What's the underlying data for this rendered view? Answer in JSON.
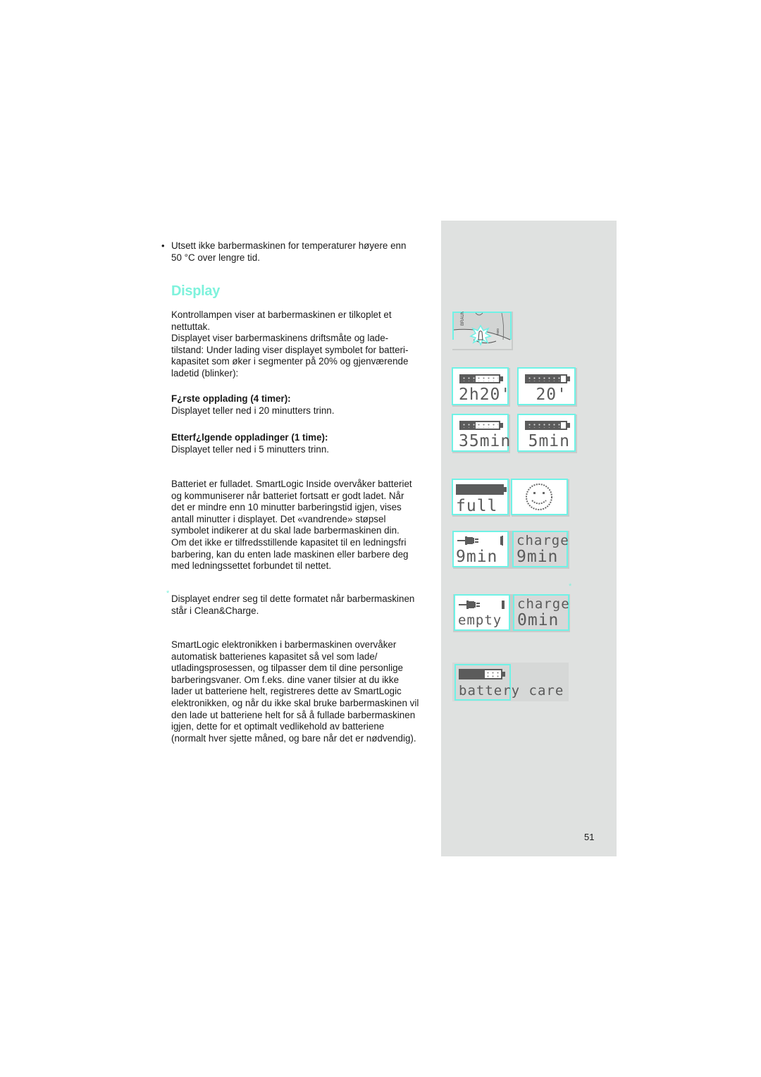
{
  "page": {
    "number": "51",
    "accent_color": "#7ef2dc",
    "sidebar_color": "#dfe1e0"
  },
  "content": {
    "bullet_symbol": "•",
    "warning_lines": [
      "Utsett ikke barbermaskinen for temperaturer høyere enn",
      "50 °C over lengre tid."
    ],
    "section_title": "Display",
    "intro_lines": [
      "Kontrollampen viser at barbermaskinen er tilkoplet et",
      "nettuttak.",
      "Displayet viser barbermaskinens driftsmåte og lade-",
      "tilstand: Under lading viser displayet symbolet for batteri-",
      "kapasitet som øker i segmenter på 20% og gjenværende",
      "ladetid (blinker):"
    ],
    "first_charge": {
      "heading": "F¿rste opplading (4 timer):",
      "text": "Displayet teller ned i 20 minutters trinn."
    },
    "subsequent_charge": {
      "heading": "Etterf¿lgende oppladinger (1 time):",
      "text": "Displayet teller ned i 5 minutters trinn."
    },
    "full_lines": [
      "Batteriet er fulladet. SmartLogic Inside overvåker batteriet",
      "og kommuniserer når batteriet fortsatt er godt ladet. Når",
      "det er mindre enn 10 minutter barberingstid igjen, vises",
      "antall minutter i displayet. Det «vandrende» støpsel",
      "symbolet indikerer at du skal lade barbermaskinen din.",
      "Om det ikke er tilfredsstillende kapasitet til en ledningsfri",
      "barbering, kan du enten lade maskinen eller barbere deg",
      "med ledningssettet forbundet til nettet."
    ],
    "footnote_marker": "*",
    "footnote_lines": [
      "Displayet endrer seg til dette formatet når barbermaskinen",
      "står i Clean&Charge."
    ],
    "smartlogic_lines": [
      "SmartLogic elektronikken i barbermaskinen overvåker",
      "automatisk batterienes kapasitet så vel som lade/",
      "utladingsprosessen, og tilpasser dem til dine personlige",
      "barberingsvaner. Om f.eks. dine vaner tilsier at du ikke",
      "lader ut batteriene helt, registreres dette av SmartLogic",
      "elektronikken, og når du ikke skal bruke barbermaskinen vil",
      "den lade ut batteriene helt for så å fullade barbermaskinen",
      "igjen, dette for et optimalt vedlikehold av batteriene",
      "(normalt hver sjette måned, og bare når det er nødvendig)."
    ]
  },
  "sidebar": {
    "shaver_illustration": {
      "brand": "BRAUN",
      "model": "7680",
      "icon": "pilot-lamp-blink-icon"
    },
    "displays": [
      {
        "id": "first-charge-2h20",
        "battery_fill": 0.4,
        "text": "2h20'"
      },
      {
        "id": "first-charge-20",
        "battery_fill": 0.85,
        "text": "20'"
      },
      {
        "id": "charge-35min",
        "battery_fill": 0.4,
        "text": "35min"
      },
      {
        "id": "charge-5min",
        "battery_fill": 0.85,
        "text": "5min"
      },
      {
        "id": "full",
        "battery_fill": 1.0,
        "text": "full"
      },
      {
        "id": "smiley",
        "icon": "smiley-icon"
      },
      {
        "id": "low-9min",
        "icon": "plug-icon",
        "text": "9min"
      },
      {
        "id": "cc-charge-9min",
        "line1": "charge",
        "line2": "9min"
      },
      {
        "id": "empty",
        "icon": "plug-icon",
        "text": "empty"
      },
      {
        "id": "cc-charge-0min",
        "line1": "charge",
        "line2": "0min"
      },
      {
        "id": "battery-care",
        "battery_fill": 0.6,
        "text": "battery care"
      }
    ],
    "footnote_marker": "*"
  }
}
